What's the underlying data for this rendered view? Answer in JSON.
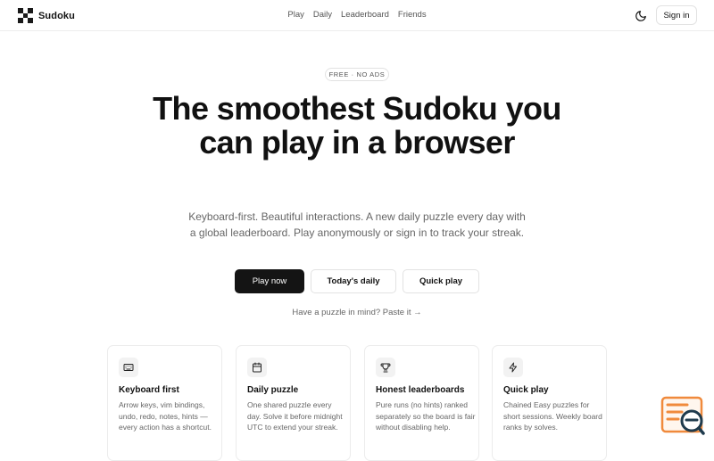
{
  "header": {
    "brand_name": "Sudoku",
    "nav": [
      "Play",
      "Daily",
      "Leaderboard",
      "Friends"
    ],
    "sign_in_label": "Sign in"
  },
  "hero": {
    "badge": "FREE · NO ADS",
    "title": "The smoothest Sudoku you can play in a browser",
    "subtitle": "Keyboard-first. Beautiful interactions. A new daily puzzle every day with a global leaderboard. Play anonymously or sign in to track your streak.",
    "cta_primary": "Play now",
    "cta_daily": "Today's daily",
    "cta_quick": "Quick play",
    "paste_link": "Have a puzzle in mind? Paste it →"
  },
  "features": [
    {
      "icon": "keyboard-icon",
      "title": "Keyboard first",
      "desc": "Arrow keys, vim bindings, undo, redo, notes, hints — every action has a shortcut."
    },
    {
      "icon": "calendar-icon",
      "title": "Daily puzzle",
      "desc": "One shared puzzle every day. Solve it before midnight UTC to extend your streak."
    },
    {
      "icon": "trophy-icon",
      "title": "Honest leaderboards",
      "desc": "Pure runs (no hints) ranked separately so the board is fair without disabling help."
    },
    {
      "icon": "lightning-icon",
      "title": "Quick play",
      "desc": "Chained Easy puzzles for short sessions. Weekly board ranks by solves."
    }
  ],
  "colors": {
    "primary": "#141414",
    "muted_text": "#666666",
    "border": "#e2e2e2",
    "widget_accent": "#f08a3c"
  },
  "icons": {
    "theme_toggle": "moon-icon",
    "helper": "helper-widget-icon"
  }
}
